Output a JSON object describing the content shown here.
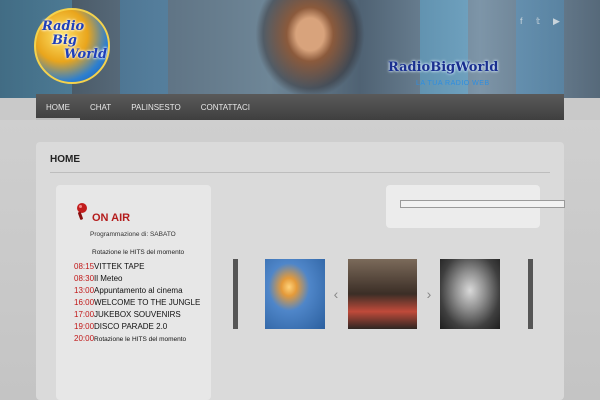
{
  "header": {
    "logo_lines": [
      "Radio",
      "Big",
      "World"
    ],
    "brand_name": "RadioBigWorld",
    "brand_tagline": "LA TUA RADIO WEB",
    "social_icons": [
      "facebook-icon",
      "twitter-icon",
      "youtube-icon"
    ]
  },
  "nav": {
    "items": [
      {
        "label": "HOME"
      },
      {
        "label": "CHAT"
      },
      {
        "label": "PALINSESTO"
      },
      {
        "label": "CONTATTACI"
      }
    ]
  },
  "page": {
    "title": "HOME"
  },
  "onair": {
    "title": "ON AIR",
    "programming_label": "Programmazione di: SABATO",
    "now_playing": "Rotazione le HITS del momento",
    "schedule": [
      {
        "time": "08:15",
        "show": "VITTEK TAPE"
      },
      {
        "time": "08:30",
        "show": "Il Meteo"
      },
      {
        "time": "13:00",
        "show": "Appuntamento al cinema"
      },
      {
        "time": "16:00",
        "show": "WELCOME TO THE JUNGLE"
      },
      {
        "time": "17:00",
        "show": "JUKEBOX SOUVENIRS"
      },
      {
        "time": "19:00",
        "show": "DISCO PARADE 2.0"
      },
      {
        "time": "20:00",
        "show": "Rotazione le HITS del momento"
      }
    ]
  },
  "colors": {
    "accent_red": "#c01818",
    "nav_bg": "#4a4a4a"
  }
}
